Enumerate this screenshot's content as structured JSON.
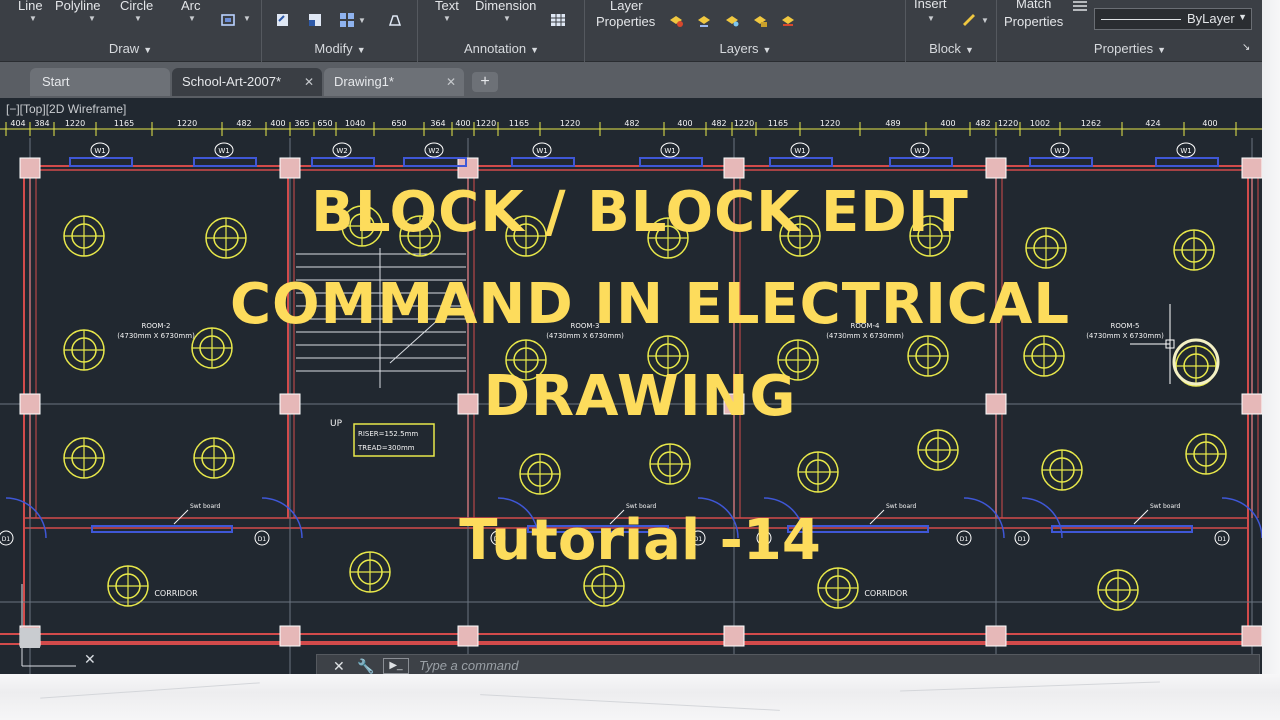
{
  "ribbon": {
    "draw": {
      "line": "Line",
      "polyline": "Polyline",
      "circle": "Circle",
      "arc": "Arc",
      "title": "Draw"
    },
    "modify": {
      "title": "Modify"
    },
    "annotation": {
      "text": "Text",
      "dimension": "Dimension",
      "title": "Annotation"
    },
    "layers": {
      "layer_properties_1": "Layer",
      "layer_properties_2": "Properties",
      "title": "Layers"
    },
    "block": {
      "insert": "Insert",
      "title": "Block"
    },
    "properties": {
      "match_1": "Match",
      "match_2": "Properties",
      "bylayer": "ByLayer",
      "title": "Properties"
    }
  },
  "tabs": [
    {
      "label": "Start"
    },
    {
      "label": "School-Art-2007*"
    },
    {
      "label": "Drawing1*"
    }
  ],
  "viewport_label": "[−][Top][2D Wireframe]",
  "drawing": {
    "dims": [
      "404",
      "384",
      "1220",
      "1165",
      "1220",
      "482",
      "400",
      "365",
      "650",
      "1040",
      "650",
      "364",
      "400",
      "1220",
      "1165",
      "1220",
      "482",
      "400",
      "482",
      "1220",
      "1165",
      "1220",
      "489",
      "400",
      "482",
      "1220",
      "1002",
      "1262",
      "424",
      "400"
    ],
    "window_tags": [
      "W1",
      "W1",
      "W2",
      "W2",
      "W1",
      "W1",
      "W1",
      "W1",
      "W1",
      "W1"
    ],
    "door_tags": [
      "D1",
      "D1",
      "D1",
      "D1",
      "D1",
      "D1",
      "D1",
      "D1"
    ],
    "room_labels": [
      {
        "name": "ROOM-2",
        "size": "(4730mm X 6730mm)"
      },
      {
        "name": "ROOM-3",
        "size": "(4730mm X 6730mm)"
      },
      {
        "name": "ROOM-4",
        "size": "(4730mm X 6730mm)"
      },
      {
        "name": "ROOM-5",
        "size": "(4730mm X 6730mm)"
      }
    ],
    "corridor": "CORRIDOR",
    "stair_up": "UP",
    "stair_note_1": "RISER=152.5mm",
    "stair_note_2": "TREAD=300mm",
    "switch_board": "Swt board"
  },
  "command_line": {
    "placeholder": "Type  a  command"
  },
  "overlay": {
    "line1": "BLOCK / BLOCK EDIT",
    "line2": "COMMAND IN ELECTRICAL",
    "line3": "DRAWING",
    "line4": "Tutorial -14"
  },
  "colors": {
    "overlay_text": "#fddc5c",
    "canvas": "#212830",
    "ribbon": "#3b3f45",
    "fixture": "#e8e84a",
    "wall": "#d24b4b",
    "window": "#3f57d6"
  }
}
